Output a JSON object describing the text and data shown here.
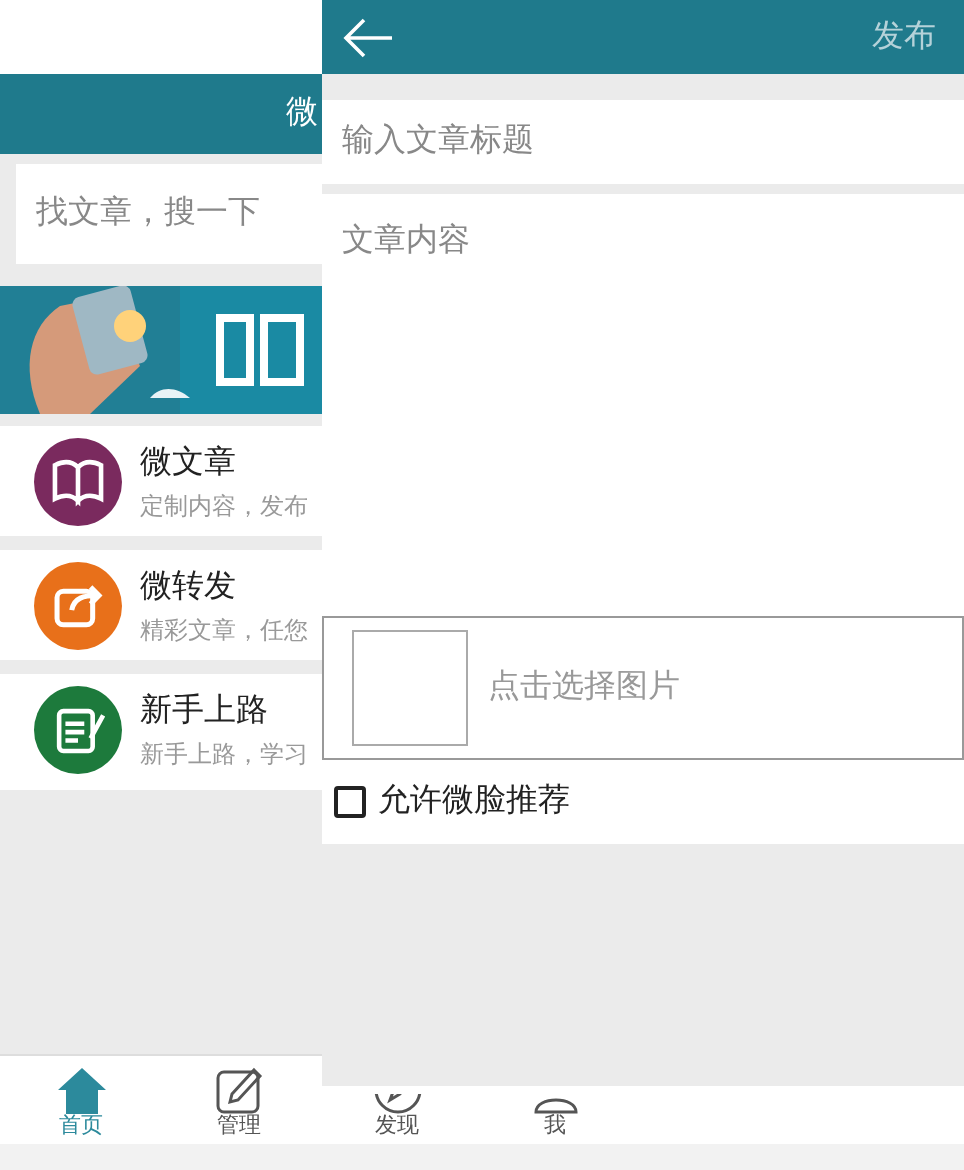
{
  "background_screen": {
    "header_title": "微",
    "search": {
      "placeholder": "找文章，搜一下"
    },
    "items": [
      {
        "title": "微文章",
        "subtitle": "定制内容，发布",
        "kind": "book",
        "color": "#7a2a5e"
      },
      {
        "title": "微转发",
        "subtitle": "精彩文章，任您",
        "kind": "share",
        "color": "#e8701a"
      },
      {
        "title": "新手上路",
        "subtitle": "新手上路，学习",
        "kind": "note",
        "color": "#1d7a3c"
      }
    ],
    "tab_bar": [
      {
        "label": "首页",
        "kind": "home",
        "selected": true
      },
      {
        "label": "管理",
        "kind": "edit",
        "selected": false
      },
      {
        "label": "发现",
        "kind": "compass",
        "selected": false
      },
      {
        "label": "我",
        "kind": "user",
        "selected": false
      }
    ]
  },
  "editor": {
    "publish": "发布",
    "title_field": {
      "placeholder": "输入文章标题"
    },
    "content_field": {
      "placeholder": "文章内容"
    },
    "image_picker": "点击选择图片",
    "recommend": {
      "label": "允许微脸推荐",
      "checked": false
    }
  }
}
